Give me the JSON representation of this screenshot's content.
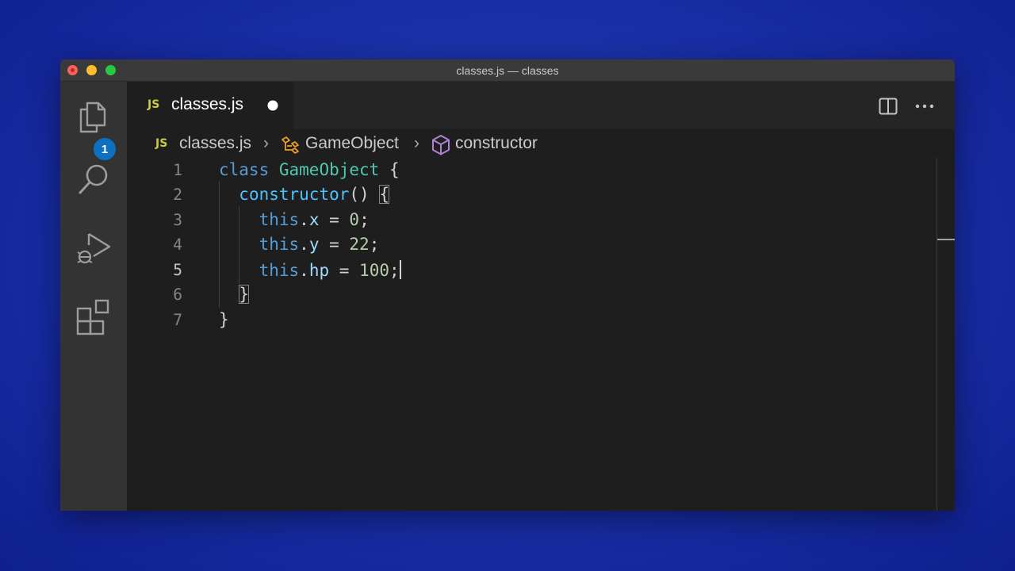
{
  "window": {
    "title": "classes.js — classes"
  },
  "activity_bar": {
    "explorer_badge": "1"
  },
  "tab": {
    "lang_tag": "JS",
    "filename": "classes.js"
  },
  "breadcrumbs": {
    "file_tag": "JS",
    "file": "classes.js",
    "class": "GameObject",
    "method": "constructor"
  },
  "editor": {
    "active_line": 5,
    "line_numbers": [
      "1",
      "2",
      "3",
      "4",
      "5",
      "6",
      "7"
    ],
    "lines": [
      "class GameObject {",
      "  constructor() {",
      "    this.x = 0;",
      "    this.y = 22;",
      "    this.hp = 100;",
      "  }",
      "}"
    ]
  },
  "colors": {
    "keyword": "#569cd6",
    "class_name": "#4ec9b0",
    "function_name": "#4fc1ff",
    "property": "#9cdcfe",
    "number": "#b5cea8",
    "js_tag": "#cbcb41"
  }
}
